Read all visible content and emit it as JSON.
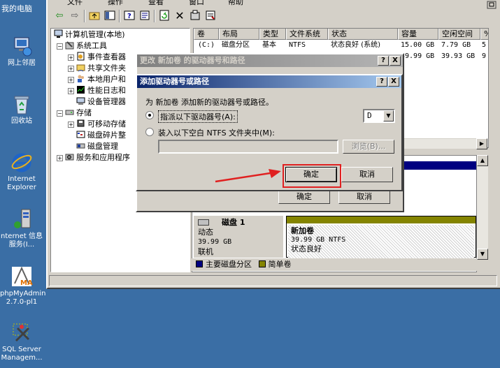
{
  "desktop": {
    "top_label": "我的电脑",
    "icons": [
      {
        "label": "网上邻居",
        "icon": "network-icon"
      },
      {
        "label": "回收站",
        "icon": "recycle-bin-icon"
      },
      {
        "label": "Internet Explorer",
        "icon": "ie-icon"
      },
      {
        "label": "nternet 信息服务(I...",
        "icon": "iis-icon"
      },
      {
        "label": "phpMyAdmin 2.7.0-pl1",
        "icon": "phpmyadmin-icon"
      },
      {
        "label": "SQL Server Managem...",
        "icon": "sql-server-icon"
      }
    ]
  },
  "menubar": {
    "items": [
      "文件",
      "操作",
      "查看",
      "窗口",
      "帮助"
    ]
  },
  "tree": {
    "items": [
      {
        "label": "计算机管理(本地)"
      },
      {
        "label": "系统工具"
      },
      {
        "label": "事件查看器"
      },
      {
        "label": "共享文件夹"
      },
      {
        "label": "本地用户和"
      },
      {
        "label": "性能日志和"
      },
      {
        "label": "设备管理器"
      },
      {
        "label": "存储"
      },
      {
        "label": "可移动存储"
      },
      {
        "label": "磁盘碎片整"
      },
      {
        "label": "磁盘管理"
      },
      {
        "label": "服务和应用程序"
      }
    ]
  },
  "list": {
    "columns": [
      "卷",
      "布局",
      "类型",
      "文件系统",
      "状态",
      "容量",
      "空闲空间",
      "%"
    ],
    "rows": [
      [
        "(C:)",
        "磁盘分区",
        "基本",
        "NTFS",
        "状态良好 (系统)",
        "15.00 GB",
        "7.79 GB",
        "5"
      ],
      [
        "",
        "",
        "",
        "",
        "",
        "39.99 GB",
        "39.93 GB",
        "9"
      ]
    ]
  },
  "lower": {
    "disk_name": "磁盘 1",
    "disk_type": "动态",
    "disk_size": "39.99 GB",
    "disk_status": "联机",
    "volume_name": "新加卷",
    "volume_size": "39.99 GB NTFS",
    "volume_status": "状态良好"
  },
  "legend": {
    "primary_label": "主要磁盘分区",
    "primary_color": "#000080",
    "simple_label": "简单卷",
    "simple_color": "#848400"
  },
  "outer_dialog": {
    "title": "更改 新加卷 的驱动器号和路径",
    "ok_label": "确定",
    "cancel_label": "取消",
    "help_label": "?",
    "close_label": "X"
  },
  "inner_dialog": {
    "title": "添加驱动器号或路径",
    "prompt": "为 新加卷 添加新的驱动器号或路径。",
    "option_assign": "指派以下驱动器号(A):",
    "option_mount": "装入以下空白 NTFS 文件夹中(M):",
    "drive_letter": "D",
    "browse_label": "浏览(B)...",
    "ok_label": "确定",
    "cancel_label": "取消",
    "help_label": "?",
    "close_label": "X"
  }
}
